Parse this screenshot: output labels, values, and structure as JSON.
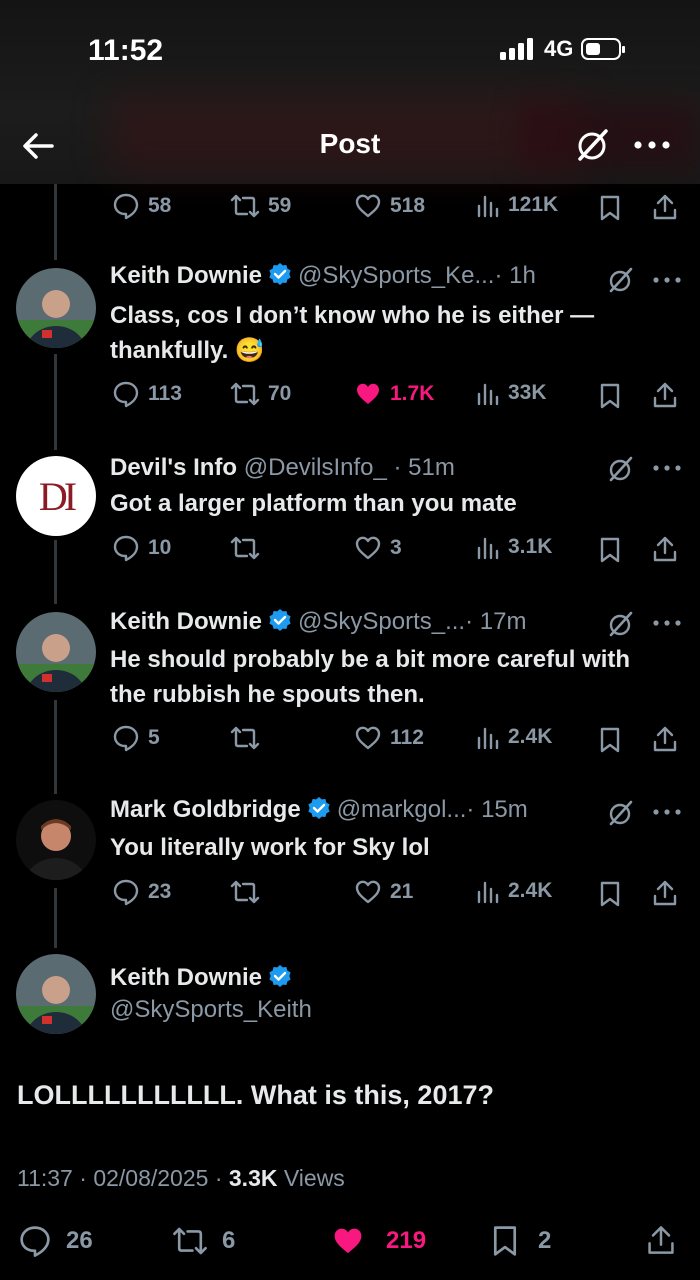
{
  "status": {
    "time": "11:52",
    "network": "4G"
  },
  "header": {
    "title": "Post"
  },
  "top_actions": {
    "replies": "58",
    "reposts": "59",
    "likes": "518",
    "views": "121K"
  },
  "replies": [
    {
      "name": "Keith Downie",
      "handle": "@SkySports_Ke...",
      "time": "· 1h",
      "text": "Class, cos I don’t know who he is either — thankfully. 😅",
      "replies": "113",
      "reposts": "70",
      "likes": "1.7K",
      "views": "33K",
      "liked": true
    },
    {
      "name": "Devil's Info",
      "handle": "@DevilsInfo_",
      "time": "· 51m",
      "text": "Got a larger platform than you mate",
      "replies": "10",
      "reposts": "",
      "likes": "3",
      "views": "3.1K",
      "liked": false,
      "avatar_text": "DI"
    },
    {
      "name": "Keith Downie",
      "handle": "@SkySports_...",
      "time": "· 17m",
      "text": "He should probably be a bit more careful with the rubbish he spouts then.",
      "replies": "5",
      "reposts": "",
      "likes": "112",
      "views": "2.4K",
      "liked": false
    },
    {
      "name": "Mark Goldbridge",
      "handle": "@markgol...",
      "time": "· 15m",
      "text": "You literally work for Sky lol",
      "replies": "23",
      "reposts": "",
      "likes": "21",
      "views": "2.4K",
      "liked": false
    }
  ],
  "main_post": {
    "name": "Keith Downie",
    "handle": "@SkySports_Keith",
    "text": "LOLLLLLLLLLLL. What is this, 2017?",
    "time": "11:37",
    "date": "02/08/2025",
    "views": "3.3K",
    "views_label": "Views",
    "replies": "26",
    "reposts": "6",
    "likes": "219",
    "bookmarks": "2"
  },
  "colors": {
    "accent_like": "#f91880",
    "verified": "#1d9bf0",
    "muted": "#8b98a5"
  }
}
